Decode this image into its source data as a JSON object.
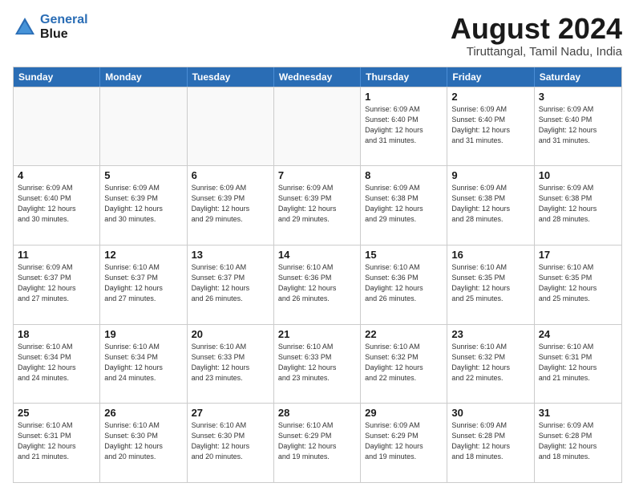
{
  "logo": {
    "line1": "General",
    "line2": "Blue"
  },
  "title": "August 2024",
  "subtitle": "Tiruttangal, Tamil Nadu, India",
  "header_days": [
    "Sunday",
    "Monday",
    "Tuesday",
    "Wednesday",
    "Thursday",
    "Friday",
    "Saturday"
  ],
  "rows": [
    [
      {
        "day": "",
        "detail": "",
        "empty": true
      },
      {
        "day": "",
        "detail": "",
        "empty": true
      },
      {
        "day": "",
        "detail": "",
        "empty": true
      },
      {
        "day": "",
        "detail": "",
        "empty": true
      },
      {
        "day": "1",
        "detail": "Sunrise: 6:09 AM\nSunset: 6:40 PM\nDaylight: 12 hours\nand 31 minutes."
      },
      {
        "day": "2",
        "detail": "Sunrise: 6:09 AM\nSunset: 6:40 PM\nDaylight: 12 hours\nand 31 minutes."
      },
      {
        "day": "3",
        "detail": "Sunrise: 6:09 AM\nSunset: 6:40 PM\nDaylight: 12 hours\nand 31 minutes."
      }
    ],
    [
      {
        "day": "4",
        "detail": "Sunrise: 6:09 AM\nSunset: 6:40 PM\nDaylight: 12 hours\nand 30 minutes."
      },
      {
        "day": "5",
        "detail": "Sunrise: 6:09 AM\nSunset: 6:39 PM\nDaylight: 12 hours\nand 30 minutes."
      },
      {
        "day": "6",
        "detail": "Sunrise: 6:09 AM\nSunset: 6:39 PM\nDaylight: 12 hours\nand 29 minutes."
      },
      {
        "day": "7",
        "detail": "Sunrise: 6:09 AM\nSunset: 6:39 PM\nDaylight: 12 hours\nand 29 minutes."
      },
      {
        "day": "8",
        "detail": "Sunrise: 6:09 AM\nSunset: 6:38 PM\nDaylight: 12 hours\nand 29 minutes."
      },
      {
        "day": "9",
        "detail": "Sunrise: 6:09 AM\nSunset: 6:38 PM\nDaylight: 12 hours\nand 28 minutes."
      },
      {
        "day": "10",
        "detail": "Sunrise: 6:09 AM\nSunset: 6:38 PM\nDaylight: 12 hours\nand 28 minutes."
      }
    ],
    [
      {
        "day": "11",
        "detail": "Sunrise: 6:09 AM\nSunset: 6:37 PM\nDaylight: 12 hours\nand 27 minutes."
      },
      {
        "day": "12",
        "detail": "Sunrise: 6:10 AM\nSunset: 6:37 PM\nDaylight: 12 hours\nand 27 minutes."
      },
      {
        "day": "13",
        "detail": "Sunrise: 6:10 AM\nSunset: 6:37 PM\nDaylight: 12 hours\nand 26 minutes."
      },
      {
        "day": "14",
        "detail": "Sunrise: 6:10 AM\nSunset: 6:36 PM\nDaylight: 12 hours\nand 26 minutes."
      },
      {
        "day": "15",
        "detail": "Sunrise: 6:10 AM\nSunset: 6:36 PM\nDaylight: 12 hours\nand 26 minutes."
      },
      {
        "day": "16",
        "detail": "Sunrise: 6:10 AM\nSunset: 6:35 PM\nDaylight: 12 hours\nand 25 minutes."
      },
      {
        "day": "17",
        "detail": "Sunrise: 6:10 AM\nSunset: 6:35 PM\nDaylight: 12 hours\nand 25 minutes."
      }
    ],
    [
      {
        "day": "18",
        "detail": "Sunrise: 6:10 AM\nSunset: 6:34 PM\nDaylight: 12 hours\nand 24 minutes."
      },
      {
        "day": "19",
        "detail": "Sunrise: 6:10 AM\nSunset: 6:34 PM\nDaylight: 12 hours\nand 24 minutes."
      },
      {
        "day": "20",
        "detail": "Sunrise: 6:10 AM\nSunset: 6:33 PM\nDaylight: 12 hours\nand 23 minutes."
      },
      {
        "day": "21",
        "detail": "Sunrise: 6:10 AM\nSunset: 6:33 PM\nDaylight: 12 hours\nand 23 minutes."
      },
      {
        "day": "22",
        "detail": "Sunrise: 6:10 AM\nSunset: 6:32 PM\nDaylight: 12 hours\nand 22 minutes."
      },
      {
        "day": "23",
        "detail": "Sunrise: 6:10 AM\nSunset: 6:32 PM\nDaylight: 12 hours\nand 22 minutes."
      },
      {
        "day": "24",
        "detail": "Sunrise: 6:10 AM\nSunset: 6:31 PM\nDaylight: 12 hours\nand 21 minutes."
      }
    ],
    [
      {
        "day": "25",
        "detail": "Sunrise: 6:10 AM\nSunset: 6:31 PM\nDaylight: 12 hours\nand 21 minutes."
      },
      {
        "day": "26",
        "detail": "Sunrise: 6:10 AM\nSunset: 6:30 PM\nDaylight: 12 hours\nand 20 minutes."
      },
      {
        "day": "27",
        "detail": "Sunrise: 6:10 AM\nSunset: 6:30 PM\nDaylight: 12 hours\nand 20 minutes."
      },
      {
        "day": "28",
        "detail": "Sunrise: 6:10 AM\nSunset: 6:29 PM\nDaylight: 12 hours\nand 19 minutes."
      },
      {
        "day": "29",
        "detail": "Sunrise: 6:09 AM\nSunset: 6:29 PM\nDaylight: 12 hours\nand 19 minutes."
      },
      {
        "day": "30",
        "detail": "Sunrise: 6:09 AM\nSunset: 6:28 PM\nDaylight: 12 hours\nand 18 minutes."
      },
      {
        "day": "31",
        "detail": "Sunrise: 6:09 AM\nSunset: 6:28 PM\nDaylight: 12 hours\nand 18 minutes."
      }
    ]
  ]
}
